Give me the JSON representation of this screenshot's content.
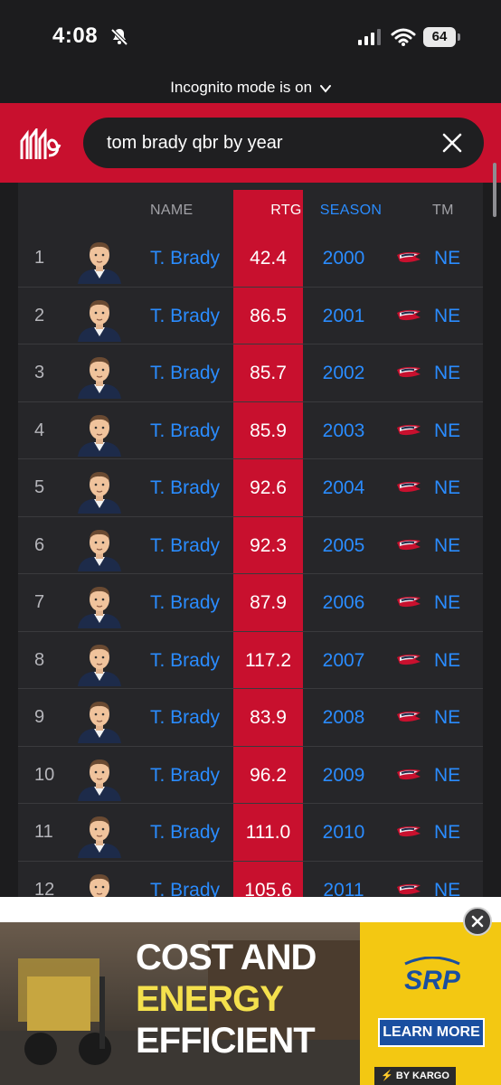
{
  "status_bar": {
    "time": "4:08",
    "battery": "64",
    "icons": [
      "bell-slash-icon",
      "signal-icon",
      "wifi-icon",
      "battery-icon"
    ]
  },
  "incognito": {
    "label": "Incognito mode is on"
  },
  "search": {
    "query": "tom brady qbr by year",
    "clear_icon": "close-icon",
    "logo_icon": "statmuse-logo"
  },
  "table": {
    "headers": {
      "name": "NAME",
      "rtg": "RTG",
      "season": "SEASON",
      "tm": "TM"
    },
    "rows": [
      {
        "rank": "1",
        "name": "T. Brady",
        "rtg": "42.4",
        "season": "2000",
        "team": "NE"
      },
      {
        "rank": "2",
        "name": "T. Brady",
        "rtg": "86.5",
        "season": "2001",
        "team": "NE"
      },
      {
        "rank": "3",
        "name": "T. Brady",
        "rtg": "85.7",
        "season": "2002",
        "team": "NE"
      },
      {
        "rank": "4",
        "name": "T. Brady",
        "rtg": "85.9",
        "season": "2003",
        "team": "NE"
      },
      {
        "rank": "5",
        "name": "T. Brady",
        "rtg": "92.6",
        "season": "2004",
        "team": "NE"
      },
      {
        "rank": "6",
        "name": "T. Brady",
        "rtg": "92.3",
        "season": "2005",
        "team": "NE"
      },
      {
        "rank": "7",
        "name": "T. Brady",
        "rtg": "87.9",
        "season": "2006",
        "team": "NE"
      },
      {
        "rank": "8",
        "name": "T. Brady",
        "rtg": "117.2",
        "season": "2007",
        "team": "NE"
      },
      {
        "rank": "9",
        "name": "T. Brady",
        "rtg": "83.9",
        "season": "2008",
        "team": "NE"
      },
      {
        "rank": "10",
        "name": "T. Brady",
        "rtg": "96.2",
        "season": "2009",
        "team": "NE"
      },
      {
        "rank": "11",
        "name": "T. Brady",
        "rtg": "111.0",
        "season": "2010",
        "team": "NE"
      },
      {
        "rank": "12",
        "name": "T. Brady",
        "rtg": "105.6",
        "season": "2011",
        "team": "NE"
      }
    ]
  },
  "ad": {
    "headline": [
      "COST AND",
      "ENERGY",
      "EFFICIENT"
    ],
    "brand": "SRP",
    "cta": "LEARN MORE",
    "attribution": "⚡ BY KARGO",
    "close_icon": "close-icon"
  },
  "colors": {
    "accent_red": "#c8102e",
    "link_blue": "#2a8cff",
    "background": "#1c1c1e",
    "ad_yellow": "#f3c812"
  }
}
